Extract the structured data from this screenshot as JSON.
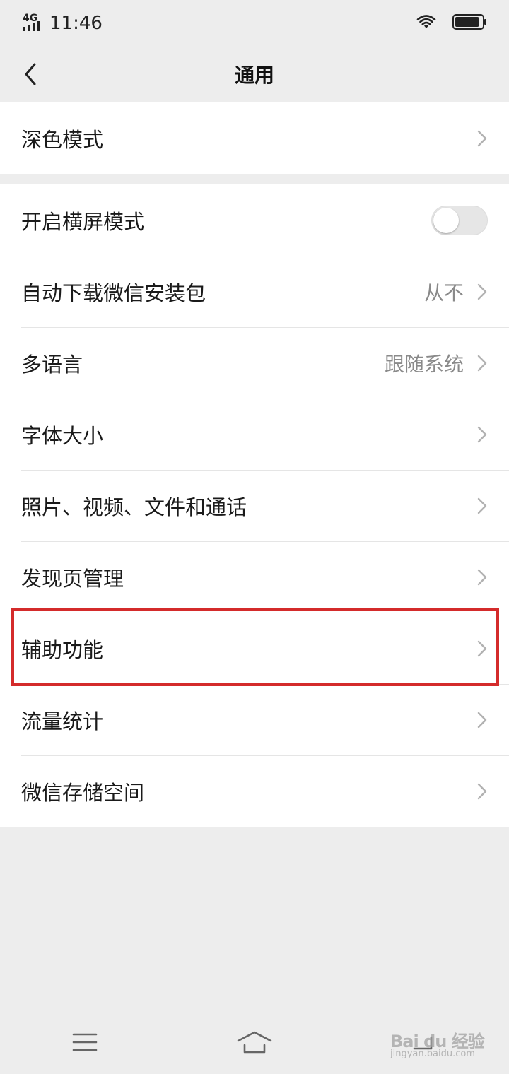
{
  "status_bar": {
    "network": "4G",
    "time": "11:46",
    "battery_level": 0.9
  },
  "nav": {
    "title": "通用"
  },
  "group1": {
    "rows": [
      {
        "label": "深色模式"
      }
    ]
  },
  "group2": {
    "rows": [
      {
        "label": "开启横屏模式",
        "toggle_on": false
      },
      {
        "label": "自动下载微信安装包",
        "value": "从不"
      },
      {
        "label": "多语言",
        "value": "跟随系统"
      },
      {
        "label": "字体大小"
      },
      {
        "label": "照片、视频、文件和通话"
      },
      {
        "label": "发现页管理"
      },
      {
        "label": "辅助功能",
        "highlighted": true
      },
      {
        "label": "流量统计"
      },
      {
        "label": "微信存储空间"
      }
    ]
  },
  "colors": {
    "background": "#ededed",
    "highlight": "#d42b2b",
    "secondary_text": "#8a8a8a"
  },
  "bottom_nav": {
    "items": [
      "menu-icon",
      "home-icon",
      "back-icon"
    ]
  },
  "watermark": {
    "main": "Bai du 经验",
    "sub": "jingyan.baidu.com"
  }
}
